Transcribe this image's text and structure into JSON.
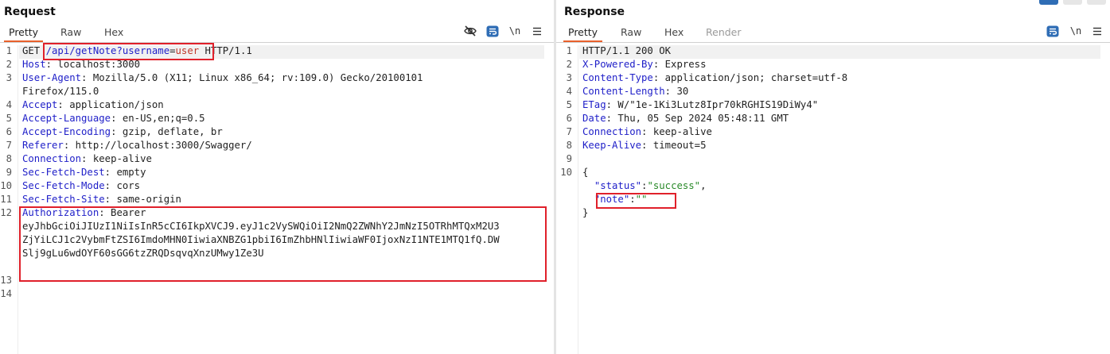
{
  "request": {
    "title": "Request",
    "tabs": [
      {
        "label": "Pretty",
        "active": true
      },
      {
        "label": "Raw",
        "active": false
      },
      {
        "label": "Hex",
        "active": false
      }
    ],
    "toolbar": {
      "newline_label": "\\n",
      "icons": [
        "eye-slash-icon",
        "wrap-icon",
        "newline-icon",
        "menu-icon"
      ]
    },
    "lines": [
      {
        "n": "1",
        "method": "GET ",
        "path": "/api/getNote?",
        "param": "username",
        "eq": "=",
        "value": "user",
        "rest": " HTTP/1.1"
      },
      {
        "n": "2",
        "name": "Host",
        "value": ": localhost:3000"
      },
      {
        "n": "3",
        "name": "User-Agent",
        "value": ": Mozilla/5.0 (X11; Linux x86_64; rv:109.0) Gecko/20100101"
      },
      {
        "n": "",
        "text": "Firefox/115.0"
      },
      {
        "n": "4",
        "name": "Accept",
        "value": ": application/json"
      },
      {
        "n": "5",
        "name": "Accept-Language",
        "value": ": en-US,en;q=0.5"
      },
      {
        "n": "6",
        "name": "Accept-Encoding",
        "value": ": gzip, deflate, br"
      },
      {
        "n": "7",
        "name": "Referer",
        "value": ": http://localhost:3000/Swagger/"
      },
      {
        "n": "8",
        "name": "Connection",
        "value": ": keep-alive"
      },
      {
        "n": "9",
        "name": "Sec-Fetch-Dest",
        "value": ": empty"
      },
      {
        "n": "10",
        "name": "Sec-Fetch-Mode",
        "value": ": cors"
      },
      {
        "n": "11",
        "name": "Sec-Fetch-Site",
        "value": ": same-origin"
      },
      {
        "n": "12",
        "name": "Authorization",
        "value": ": Bearer"
      },
      {
        "n": "",
        "text": "eyJhbGciOiJIUzI1NiIsInR5cCI6IkpXVCJ9.eyJ1c2VySWQiOiI2NmQ2ZWNhY2JmNzI5OTRhMTQxM2U3"
      },
      {
        "n": "",
        "text": "ZjYiLCJ1c2VybmFtZSI6ImdoMHN0IiwiaXNBZG1pbiI6ImZhbHNlIiwiaWF0IjoxNzI1NTE1MTQ1fQ.DW"
      },
      {
        "n": "",
        "text": "Slj9gLu6wdOYF60sGG6tzZRQDsqvqXnzUMwy1Ze3U"
      },
      {
        "n": "",
        "text": ""
      },
      {
        "n": "13",
        "text": ""
      },
      {
        "n": "14",
        "text": ""
      }
    ]
  },
  "response": {
    "title": "Response",
    "tabs": [
      {
        "label": "Pretty",
        "active": true
      },
      {
        "label": "Raw",
        "active": false
      },
      {
        "label": "Hex",
        "active": false
      },
      {
        "label": "Render",
        "active": false,
        "disabled": true
      }
    ],
    "toolbar": {
      "newline_label": "\\n",
      "icons": [
        "wrap-icon",
        "newline-icon",
        "menu-icon"
      ]
    },
    "lines": [
      {
        "n": "1",
        "text": "HTTP/1.1 200 OK"
      },
      {
        "n": "2",
        "name": "X-Powered-By",
        "value": ": Express"
      },
      {
        "n": "3",
        "name": "Content-Type",
        "value": ": application/json; charset=utf-8"
      },
      {
        "n": "4",
        "name": "Content-Length",
        "value": ": 30"
      },
      {
        "n": "5",
        "name": "ETag",
        "value": ": W/\"1e-1Ki3Lutz8Ipr70kRGHIS19DiWy4\""
      },
      {
        "n": "6",
        "name": "Date",
        "value": ": Thu, 05 Sep 2024 05:48:11 GMT"
      },
      {
        "n": "7",
        "name": "Connection",
        "value": ": keep-alive"
      },
      {
        "n": "8",
        "name": "Keep-Alive",
        "value": ": timeout=5"
      },
      {
        "n": "9",
        "text": ""
      },
      {
        "n": "10",
        "text": "{"
      },
      {
        "n": "",
        "indent": "  ",
        "key": "\"status\"",
        "colon": ":",
        "str": "\"success\"",
        "tail": ","
      },
      {
        "n": "",
        "indent": "  ",
        "key": "\"note\"",
        "colon": ":",
        "str": "\"\"",
        "tail": ""
      },
      {
        "n": "",
        "text": "}"
      }
    ]
  },
  "colors": {
    "accent": "#e8612c",
    "highlight_box": "#e0202a",
    "header_name": "#1e1ec8",
    "json_string": "#2a8a2a",
    "url_value": "#c0392b"
  }
}
